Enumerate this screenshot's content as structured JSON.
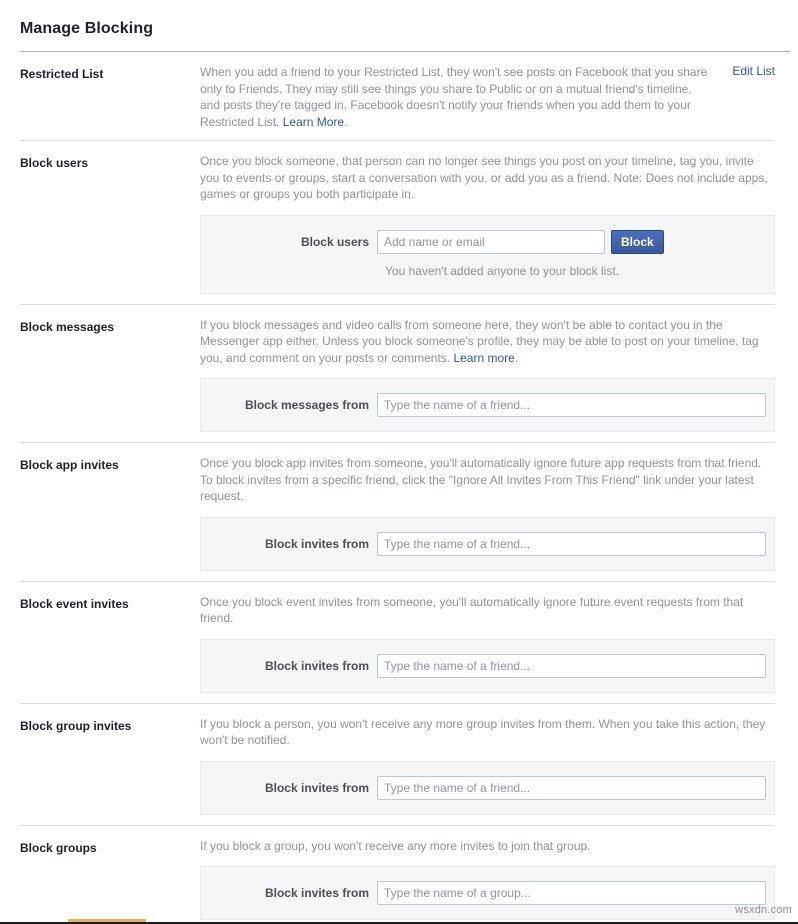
{
  "page": {
    "title": "Manage Blocking",
    "watermark": "wsxdn.com"
  },
  "colors": {
    "accent_button": "#3b5998",
    "link": "#365899",
    "muted_text": "#90949c",
    "panel_bg": "#f5f6f7"
  },
  "sections": [
    {
      "id": "restricted-list",
      "label": "Restricted List",
      "description_before_link": "When you add a friend to your Restricted List, they won't see posts on Facebook that you share only to Friends. They may still see things you share to Public or on a mutual friend's timeline, and posts they're tagged in. Facebook doesn't notify your friends when you add them to your Restricted List. ",
      "description_link": "Learn More",
      "description_after_link": ".",
      "action_label": "Edit List",
      "panel": null
    },
    {
      "id": "block-users",
      "label": "Block users",
      "description_before_link": "Once you block someone, that person can no longer see things you post on your timeline, tag you, invite you to events or groups, start a conversation with you, or add you as a friend. Note: Does not include apps, games or groups you both participate in.",
      "description_link": "",
      "description_after_link": "",
      "action_label": "",
      "panel": {
        "field_label": "Block users",
        "input_value": "",
        "input_placeholder": "Add name or email",
        "button_label": "Block",
        "note": "You haven't added anyone to your block list."
      }
    },
    {
      "id": "block-messages",
      "label": "Block messages",
      "description_before_link": "If you block messages and video calls from someone here, they won't be able to contact you in the Messenger app either. Unless you block someone's profile, they may be able to post on your timeline, tag you, and comment on your posts or comments. ",
      "description_link": "Learn more",
      "description_after_link": ".",
      "action_label": "",
      "panel": {
        "field_label": "Block messages from",
        "input_value": "",
        "input_placeholder": "Type the name of a friend...",
        "button_label": "",
        "note": ""
      }
    },
    {
      "id": "block-app-invites",
      "label": "Block app invites",
      "description_before_link": "Once you block app invites from someone, you'll automatically ignore future app requests from that friend. To block invites from a specific friend, click the \"Ignore All Invites From This Friend\" link under your latest request.",
      "description_link": "",
      "description_after_link": "",
      "action_label": "",
      "panel": {
        "field_label": "Block invites from",
        "input_value": "",
        "input_placeholder": "Type the name of a friend...",
        "button_label": "",
        "note": ""
      }
    },
    {
      "id": "block-event-invites",
      "label": "Block event invites",
      "description_before_link": "Once you block event invites from someone, you'll automatically ignore future event requests from that friend.",
      "description_link": "",
      "description_after_link": "",
      "action_label": "",
      "panel": {
        "field_label": "Block invites from",
        "input_value": "",
        "input_placeholder": "Type the name of a friend...",
        "button_label": "",
        "note": ""
      }
    },
    {
      "id": "block-group-invites",
      "label": "Block group invites",
      "description_before_link": "If you block a person, you won't receive any more group invites from them. When you take this action, they won't be notified.",
      "description_link": "",
      "description_after_link": "",
      "action_label": "",
      "panel": {
        "field_label": "Block invites from",
        "input_value": "",
        "input_placeholder": "Type the name of a friend...",
        "button_label": "",
        "note": ""
      }
    },
    {
      "id": "block-groups",
      "label": "Block groups",
      "description_before_link": "If you block a group, you won't receive any more invites to join that group.",
      "description_link": "",
      "description_after_link": "",
      "action_label": "",
      "panel": {
        "field_label": "Block invites from",
        "input_value": "",
        "input_placeholder": "Type the name of a group...",
        "button_label": "",
        "note": ""
      }
    }
  ]
}
